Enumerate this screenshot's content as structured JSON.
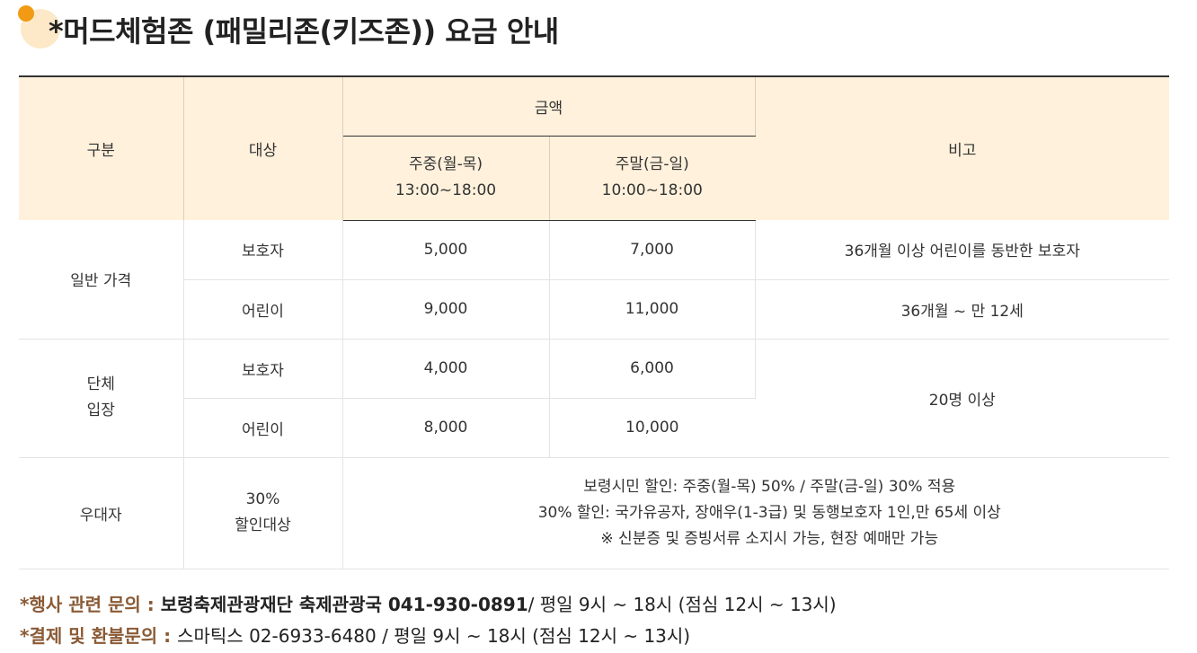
{
  "title": "*머드체험존 (패밀리존(키즈존)) 요금 안내",
  "table": {
    "headers": {
      "category": "구분",
      "target": "대상",
      "amount": "금액",
      "weekday_l1": "주중(월-목)",
      "weekday_l2": "13:00~18:00",
      "weekend_l1": "주말(금-일)",
      "weekend_l2": "10:00~18:00",
      "remarks": "비고"
    },
    "general": {
      "label": "일반 가격",
      "guardian": {
        "target": "보호자",
        "weekday": "5,000",
        "weekend": "7,000",
        "remark": "36개월 이상 어린이를 동반한 보호자"
      },
      "child": {
        "target": "어린이",
        "weekday": "9,000",
        "weekend": "11,000",
        "remark": "36개월 ~ 만 12세"
      }
    },
    "group": {
      "label_l1": "단체",
      "label_l2": "입장",
      "guardian": {
        "target": "보호자",
        "weekday": "4,000",
        "weekend": "6,000"
      },
      "child": {
        "target": "어린이",
        "weekday": "8,000",
        "weekend": "10,000"
      },
      "remark": "20명 이상"
    },
    "preferential": {
      "label": "우대자",
      "target_l1": "30%",
      "target_l2": "할인대상",
      "notes": [
        "보령시민 할인: 주중(월-목) 50% / 주말(금-일) 30% 적용",
        "30% 할인: 국가유공자, 장애우(1-3급) 및 동행보호자 1인,만 65세 이상",
        "※ 신분증 및 증빙서류 소지시 가능, 현장 예매만 가능"
      ]
    }
  },
  "contacts": {
    "event": {
      "label": "*행사 관련 문의 : ",
      "org": "보령축제관광재단 축제관광국 041-930-0891",
      "hours": "/ 평일 9시 ~ 18시 (점심 12시 ~ 13시)"
    },
    "payment": {
      "label": "*결제 및 환불문의 : ",
      "text": "스마틱스 02-6933-6480 / 평일 9시 ~ 18시 (점심 12시 ~ 13시)"
    }
  },
  "colors": {
    "header_bg": "#fff1dc",
    "price": "#1a56b0",
    "accent": "#f29a14",
    "label_brown": "#8a5a35"
  },
  "icons": {
    "title_decoration": "orange-circle-icon"
  }
}
